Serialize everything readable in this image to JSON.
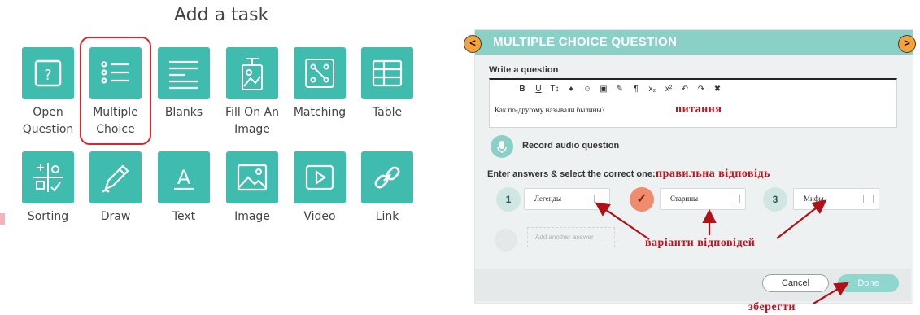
{
  "add_task": {
    "title": "Add a task",
    "tasks": [
      {
        "label": "Open",
        "label2": "Question",
        "icon": "question-box-icon"
      },
      {
        "label": "Multiple",
        "label2": "Choice",
        "icon": "list-icon"
      },
      {
        "label": "Blanks",
        "label2": "",
        "icon": "lines-icon"
      },
      {
        "label": "Fill On An",
        "label2": "Image",
        "icon": "image-pin-icon"
      },
      {
        "label": "Matching",
        "label2": "",
        "icon": "matching-icon"
      },
      {
        "label": "Table",
        "label2": "",
        "icon": "table-icon"
      },
      {
        "label": "Sorting",
        "label2": "",
        "icon": "sorting-icon"
      },
      {
        "label": "Draw",
        "label2": "",
        "icon": "pencil-icon"
      },
      {
        "label": "Text",
        "label2": "",
        "icon": "text-icon"
      },
      {
        "label": "Image",
        "label2": "",
        "icon": "picture-icon"
      },
      {
        "label": "Video",
        "label2": "",
        "icon": "play-icon"
      },
      {
        "label": "Link",
        "label2": "",
        "icon": "link-icon"
      }
    ]
  },
  "mcq": {
    "header": "MULTIPLE CHOICE QUESTION",
    "nav_prev": "<",
    "nav_next": ">",
    "write_label": "Write a question",
    "toolbar": [
      "B",
      "U",
      "T↕",
      "♦",
      "☺",
      "▣",
      "✎",
      "¶",
      "x₂",
      "x²",
      "↶",
      "↷",
      "✖"
    ],
    "question_text": "Как по-другому называли былины?",
    "record_label": "Record audio question",
    "answers_label": "Enter answers & select the correct one:",
    "answers": [
      {
        "num": "1",
        "text": "Легенды",
        "correct": false
      },
      {
        "num": "✓",
        "text": "Старины",
        "correct": true
      },
      {
        "num": "3",
        "text": "Мифы",
        "correct": false
      }
    ],
    "add_answer_placeholder": "Add another answer",
    "cancel_label": "Cancel",
    "done_label": "Done"
  },
  "annotations": {
    "question": "питання",
    "correct_answer": "правильна відповідь",
    "variants": "варіанти відповідей",
    "save": "зберегти",
    "color": "#c4111b"
  },
  "colors": {
    "accent": "#3fbcae",
    "header": "#8ad0c7",
    "highlight": "#d9262c",
    "nav": "#f4a23a"
  }
}
